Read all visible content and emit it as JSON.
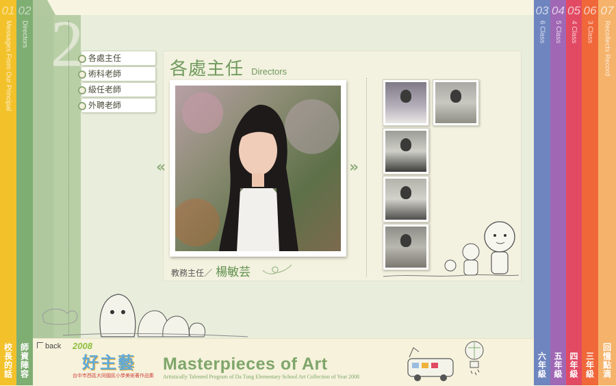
{
  "left_tabs": [
    {
      "num": "01",
      "en": "Messages From Our Principal",
      "zh": "校長的話",
      "color": "#f3c22b"
    },
    {
      "num": "02",
      "en": "Directors",
      "zh": "師資陣容",
      "color": "#7fae72"
    }
  ],
  "right_tabs": [
    {
      "num": "03",
      "en": "6 Class",
      "zh": "六年級",
      "color": "#6f85bf"
    },
    {
      "num": "04",
      "en": "5 Class",
      "zh": "五年級",
      "color": "#a067b5"
    },
    {
      "num": "05",
      "en": "4 Class",
      "zh": "四年級",
      "color": "#e24a63"
    },
    {
      "num": "06",
      "en": "3 Class",
      "zh": "三年級",
      "color": "#f0673a"
    },
    {
      "num": "07",
      "en": "Recollects Record",
      "zh": "回憶點滴",
      "color": "#f5b26a"
    }
  ],
  "section_number": "2",
  "menu": {
    "items": [
      "各處主任",
      "術科老師",
      "級任老師",
      "外聘老師"
    ]
  },
  "main": {
    "title_zh": "各處主任",
    "title_en": "Directors",
    "caption_role": "教務主任／",
    "caption_name": "楊敏芸",
    "prev_label": "«",
    "next_label": "»"
  },
  "footer": {
    "back_label": "back",
    "logo_year": "2008",
    "logo_title": "好主藝",
    "logo_sub": "台中市西區大同國民小學美術著作品集",
    "title": "Masterpieces of Art",
    "subtitle": "Artistically Talented Program of Da Tung Elementary School Art Collection of Year 2008"
  }
}
